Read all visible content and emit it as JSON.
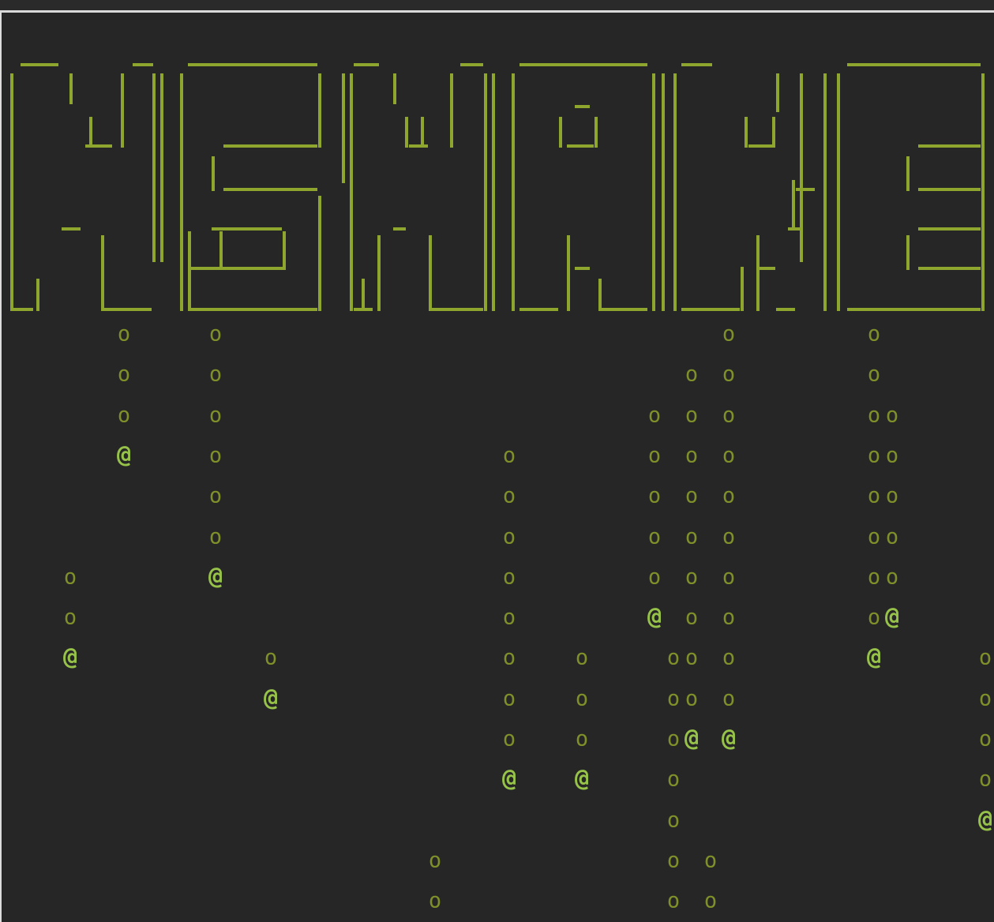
{
  "colors": {
    "background": "#262626",
    "logo": "#8fa62e",
    "tail": "#7f8f2a",
    "head": "#97c24a",
    "border": "#d9d9d9"
  },
  "symbols": {
    "tail": "o",
    "head": "@"
  },
  "logo": {
    "description_icon": "ascii-block-logo"
  }
}
